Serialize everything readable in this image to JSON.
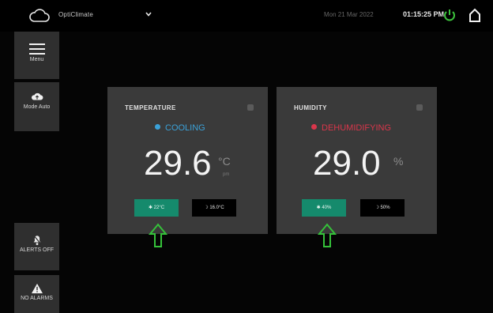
{
  "header": {
    "app_name": "OptiClimate",
    "date_text": "Mon 21 Mar 2022",
    "time_text": "01:15:25 PM"
  },
  "sidebar": {
    "menu_label": "Menu",
    "mode_label": "Mode Auto",
    "alerts_label": "ALERTS OFF",
    "alarms_label": "NO ALARMS"
  },
  "temperature": {
    "title": "TEMPERATURE",
    "status": "COOLING",
    "value": "29.6",
    "unit": "°C",
    "subunit": "pm",
    "setpoint": "22°C",
    "secondary": "16.0°C"
  },
  "humidity": {
    "title": "HUMIDITY",
    "status": "DEHUMIDIFYING",
    "value": "29.0",
    "unit": "%",
    "setpoint": "40%",
    "secondary": "50%"
  },
  "colors": {
    "accent_green": "#158a6c",
    "cooling_blue": "#3aa1d8",
    "dehumid_red": "#d9364b",
    "power_green": "#3cc23c",
    "arrow_green": "#35c23a"
  }
}
